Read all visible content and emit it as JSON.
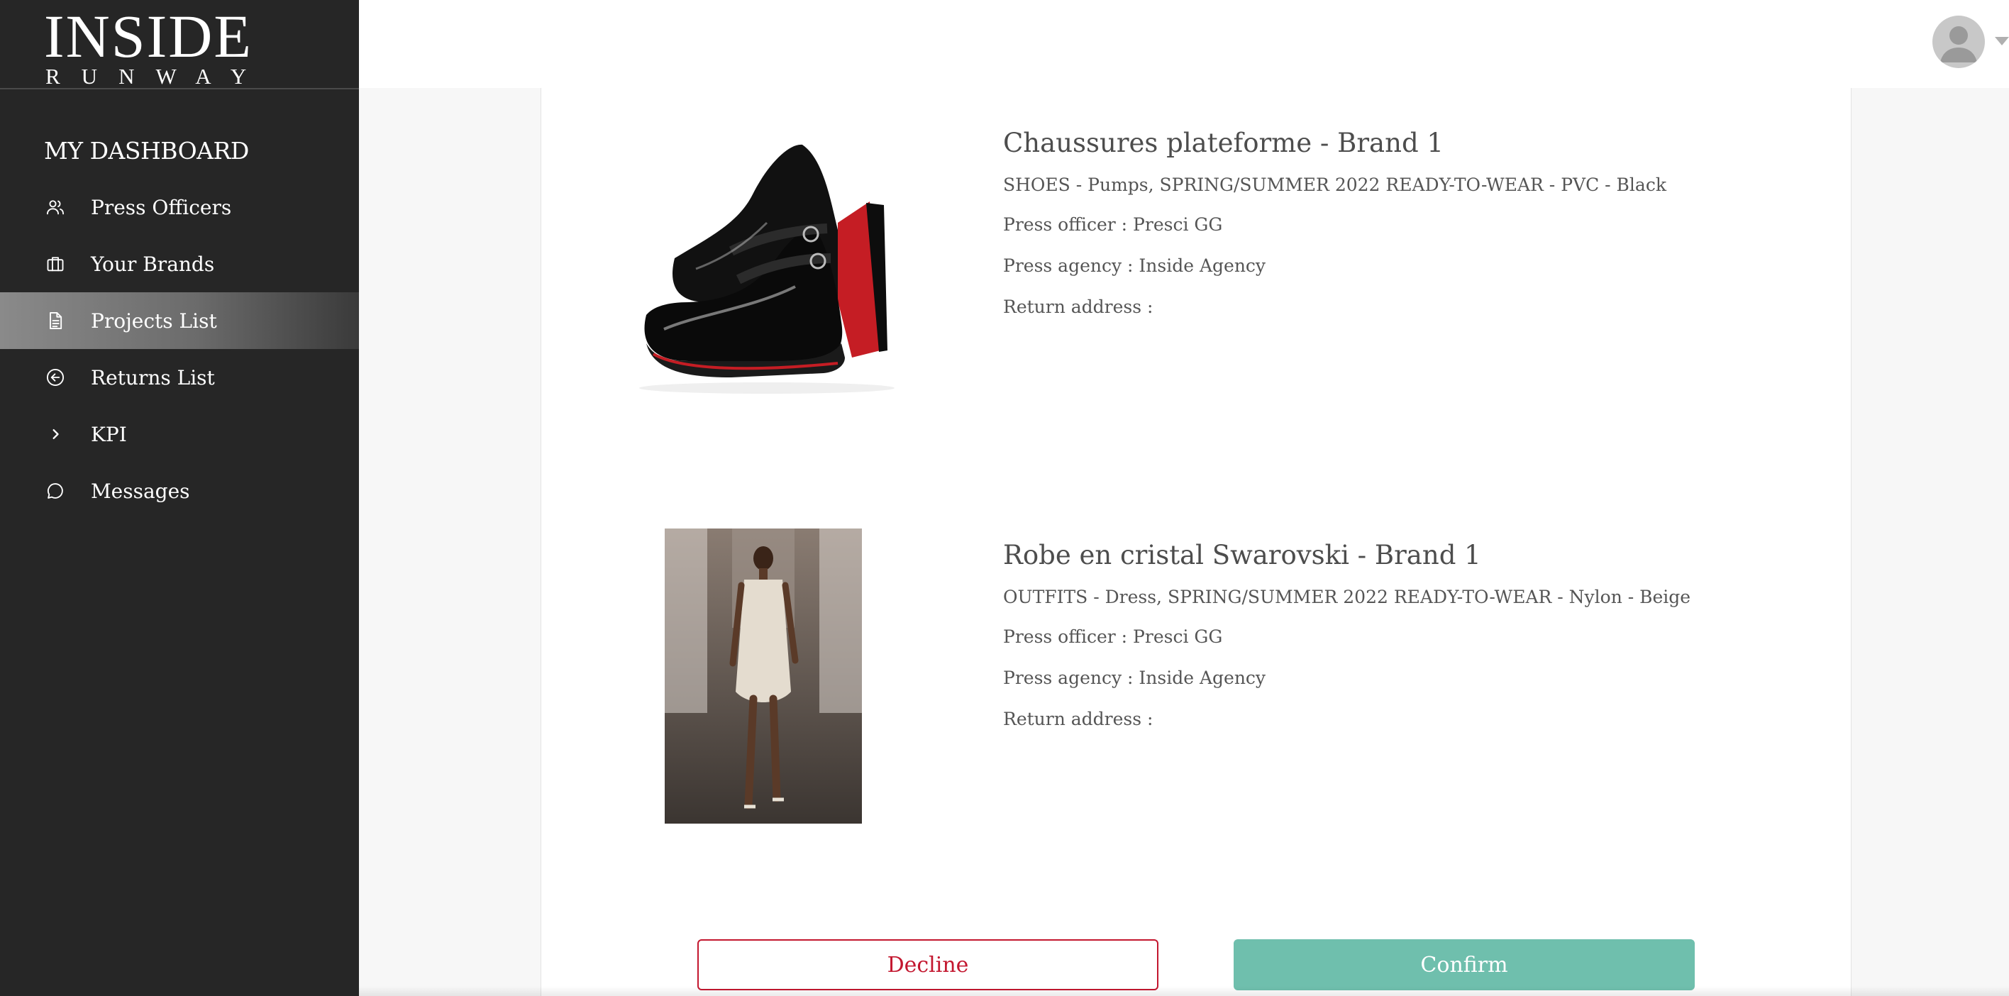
{
  "logo": {
    "main": "INSIDE",
    "sub": "RUNWAY"
  },
  "sidebar": {
    "title": "MY DASHBOARD",
    "items": [
      {
        "label": "Press Officers",
        "icon": "users-icon",
        "active": false
      },
      {
        "label": "Your Brands",
        "icon": "briefcase-icon",
        "active": false
      },
      {
        "label": "Projects List",
        "icon": "document-icon",
        "active": true
      },
      {
        "label": "Returns List",
        "icon": "arrow-left-circle-icon",
        "active": false
      },
      {
        "label": "KPI",
        "icon": "chevron-right-icon",
        "active": false
      },
      {
        "label": "Messages",
        "icon": "chat-bubble-icon",
        "active": false
      }
    ]
  },
  "header": {
    "avatar_icon": "user-avatar-icon"
  },
  "products": [
    {
      "title": "Chaussures plateforme - Brand 1",
      "details": "SHOES - Pumps, SPRING/SUMMER 2022 READY-TO-WEAR - PVC - Black",
      "press_officer": "Press officer : Presci GG",
      "press_agency": "Press agency : Inside Agency",
      "return_address": "Return address :",
      "image": "black-platform-pump-image"
    },
    {
      "title": "Robe en cristal Swarovski - Brand 1",
      "details": "OUTFITS - Dress, SPRING/SUMMER 2022 READY-TO-WEAR - Nylon - Beige",
      "press_officer": "Press officer : Presci GG",
      "press_agency": "Press agency : Inside Agency",
      "return_address": "Return address :",
      "image": "runway-model-dress-image"
    }
  ],
  "actions": {
    "decline_label": "Decline",
    "confirm_label": "Confirm"
  },
  "colors": {
    "sidebar_bg": "#262626",
    "decline": "#c3172f",
    "confirm": "#6fbfad"
  }
}
